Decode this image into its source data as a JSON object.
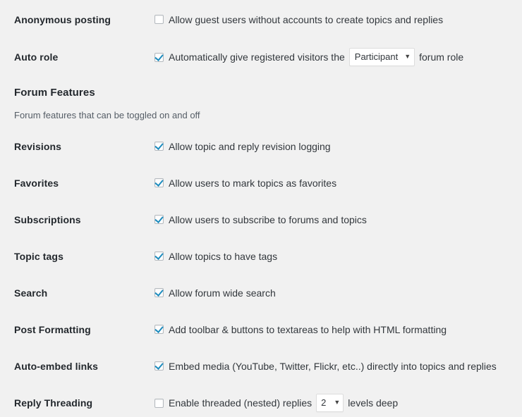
{
  "page": {
    "background_color": "#f1f1f1",
    "label_color": "#23282d",
    "text_color": "#32373c",
    "accent_color": "#1e8cbe"
  },
  "top_rows": [
    {
      "label": "Anonymous posting",
      "checkbox_checked": false,
      "text": "Allow guest users without accounts to create topics and replies"
    }
  ],
  "auto_role": {
    "label": "Auto role",
    "checkbox_checked": true,
    "text_before": "Automatically give registered visitors the",
    "select_value": "Participant",
    "select_caret": "▼",
    "text_after": "forum role"
  },
  "section": {
    "title": "Forum Features",
    "description": "Forum features that can be toggled on and off"
  },
  "feature_rows": [
    {
      "label": "Revisions",
      "checkbox_checked": true,
      "text": "Allow topic and reply revision logging"
    },
    {
      "label": "Favorites",
      "checkbox_checked": true,
      "text": "Allow users to mark topics as favorites"
    },
    {
      "label": "Subscriptions",
      "checkbox_checked": true,
      "text": "Allow users to subscribe to forums and topics"
    },
    {
      "label": "Topic tags",
      "checkbox_checked": true,
      "text": "Allow topics to have tags"
    },
    {
      "label": "Search",
      "checkbox_checked": true,
      "text": "Allow forum wide search"
    },
    {
      "label": "Post Formatting",
      "checkbox_checked": true,
      "text": "Add toolbar & buttons to textareas to help with HTML formatting"
    },
    {
      "label": "Auto-embed links",
      "checkbox_checked": true,
      "text": "Embed media (YouTube, Twitter, Flickr, etc..) directly into topics and replies"
    }
  ],
  "reply_threading": {
    "label": "Reply Threading",
    "checkbox_checked": false,
    "text_before": "Enable threaded (nested) replies",
    "select_value": "2",
    "select_caret": "▼",
    "text_after": "levels deep"
  }
}
